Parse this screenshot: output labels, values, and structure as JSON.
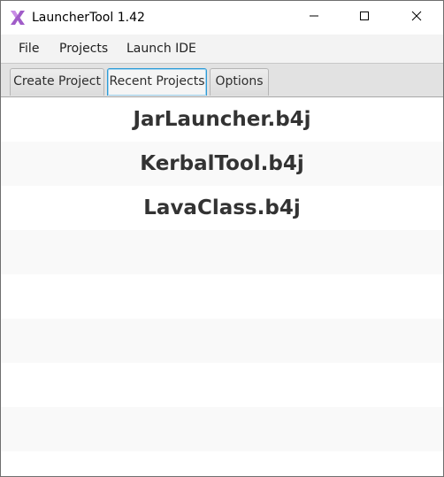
{
  "window": {
    "title": "LauncherTool 1.42",
    "icon": "x-logo-icon",
    "controls": [
      "minimize-icon",
      "maximize-icon",
      "close-icon"
    ]
  },
  "menu": {
    "items": [
      {
        "label": "File"
      },
      {
        "label": "Projects"
      },
      {
        "label": "Launch IDE"
      }
    ]
  },
  "tabs": [
    {
      "label": "Create Project",
      "selected": false
    },
    {
      "label": "Recent Projects",
      "selected": true
    },
    {
      "label": "Options",
      "selected": false
    }
  ],
  "recent_projects": [
    {
      "name": "JarLauncher.b4j"
    },
    {
      "name": "KerbalTool.b4j"
    },
    {
      "name": "LavaClass.b4j"
    }
  ],
  "colors": {
    "accent": "#2e9bd6",
    "logo": "#a05cc8",
    "row_alt": "#f9f9f9"
  }
}
